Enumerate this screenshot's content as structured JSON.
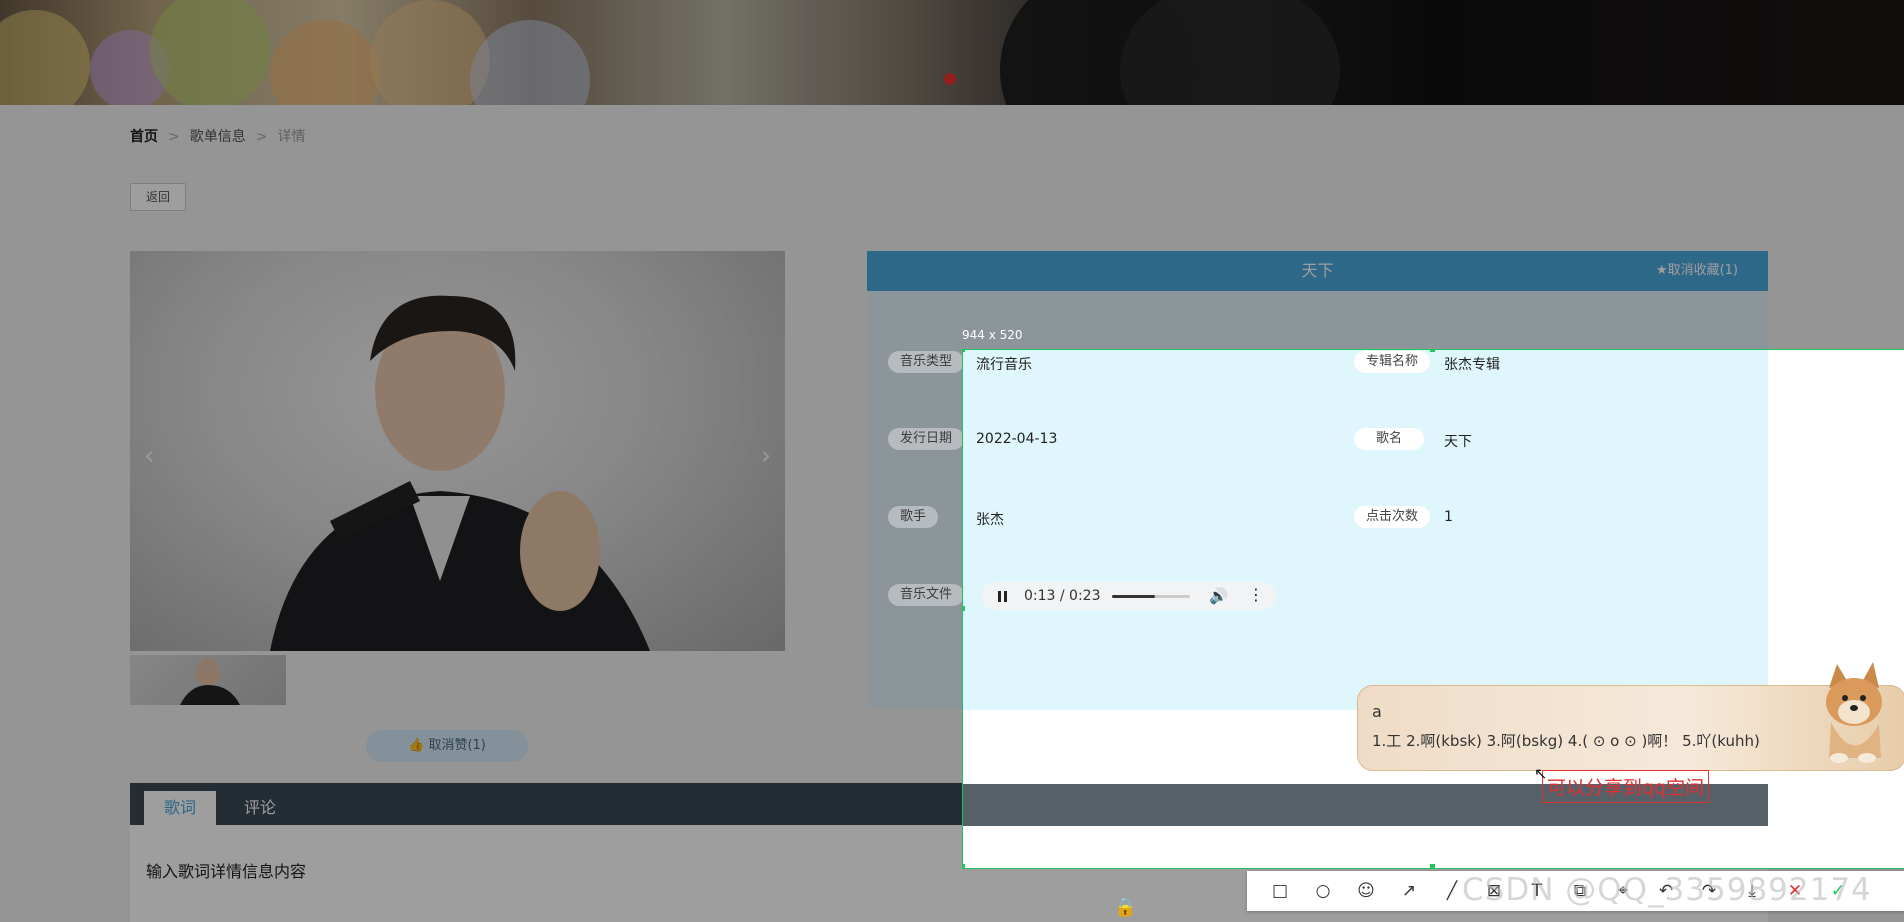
{
  "breadcrumb": {
    "home": "首页",
    "sep1": ">",
    "list": "歌单信息",
    "sep2": ">",
    "current": "详情"
  },
  "back_button": "返回",
  "like_button": "取消赞(1)",
  "song": {
    "title": "天下",
    "favorite_link": "★取消收藏(1)",
    "fields": {
      "music_type_label": "音乐类型",
      "music_type": "流行音乐",
      "album_label": "专辑名称",
      "album": "张杰专辑",
      "release_label": "发行日期",
      "release": "2022-04-13",
      "song_name_label": "歌名",
      "song_name": "天下",
      "singer_label": "歌手",
      "singer": "张杰",
      "clicks_label": "点击次数",
      "clicks": "1",
      "file_label": "音乐文件"
    },
    "player": {
      "time": "0:13 / 0:23",
      "volume_level": 0.55
    }
  },
  "tabs": {
    "lyrics": "歌词",
    "comments": "评论"
  },
  "lyrics_text": "输入歌词详情信息内容",
  "screenshot_tool": {
    "selection_size": "944 x 520",
    "annotation": "可以分享到qq空间",
    "watermark": "CSDN @QQ_3359892174",
    "tools": [
      "rectangle-icon",
      "ellipse-icon",
      "emoji-icon",
      "arrow-icon",
      "pen-icon",
      "mosaic-icon",
      "text-icon",
      "copy-icon",
      "pin-icon",
      "undo-icon",
      "redo-icon",
      "save-icon",
      "cancel-icon",
      "confirm-icon"
    ]
  },
  "ime": {
    "input": "a",
    "candidates": "1.工  2.啊(kbsk)  3.阿(bskg)  4.( ⊙ o ⊙ )啊！   5.吖(kuhh)"
  },
  "colors": {
    "accent": "#4aa8dc",
    "selection_border": "#21c55d",
    "annotation": "#e03030",
    "tab_bar": "#3d4a55"
  }
}
